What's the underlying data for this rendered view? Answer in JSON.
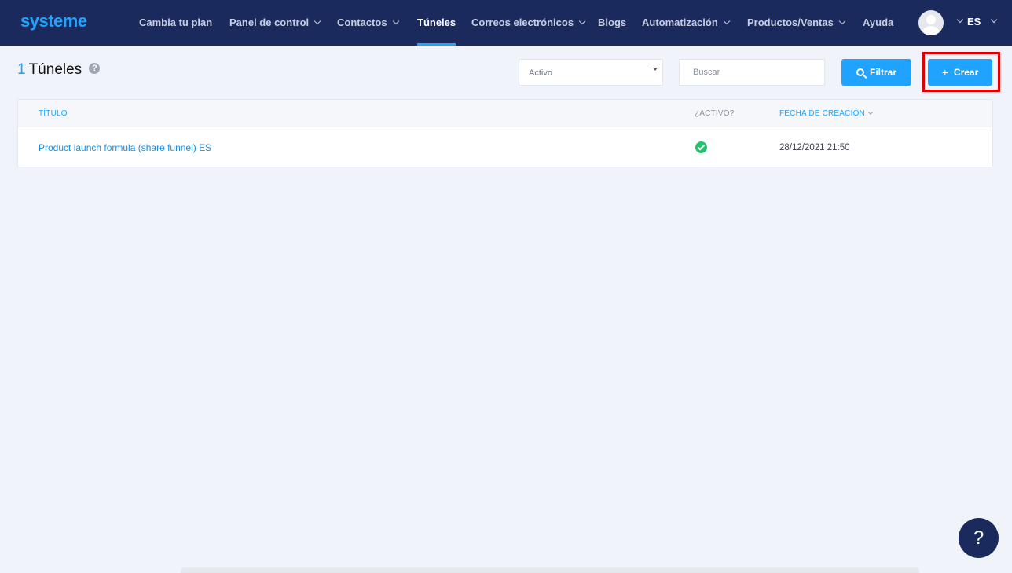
{
  "brand": {
    "logo_text": "systeme",
    "accent": "#1fa3ff",
    "nav_bg": "#1b2a5c"
  },
  "nav": {
    "items": [
      {
        "label": "Cambia tu plan"
      },
      {
        "label": "Panel de control"
      },
      {
        "label": "Contactos"
      },
      {
        "label": "Túneles"
      },
      {
        "label": "Correos electrónicos"
      },
      {
        "label": "Blogs"
      },
      {
        "label": "Automatización"
      },
      {
        "label": "Productos/Ventas"
      },
      {
        "label": "Ayuda"
      }
    ],
    "active": "Túneles",
    "language": "ES"
  },
  "header": {
    "count": "1",
    "title": "Túneles",
    "status_select": {
      "value": "Activo"
    },
    "search": {
      "placeholder": "Buscar"
    },
    "filter_label": "Filtrar",
    "create_label": "Crear"
  },
  "table": {
    "columns": [
      "TÍTULO",
      "¿ACTIVO?",
      "FECHA DE CREACIÓN"
    ],
    "rows": [
      {
        "title": "Product launch formula (share funnel) ES",
        "active": true,
        "created": "28/12/2021 21:50"
      }
    ]
  },
  "help_fab": {
    "label": "?"
  },
  "icons": [
    "help-circle-icon",
    "search-icon",
    "plus-icon",
    "check-circle-icon",
    "chevron-down-icon",
    "avatar-icon",
    "question-icon"
  ]
}
